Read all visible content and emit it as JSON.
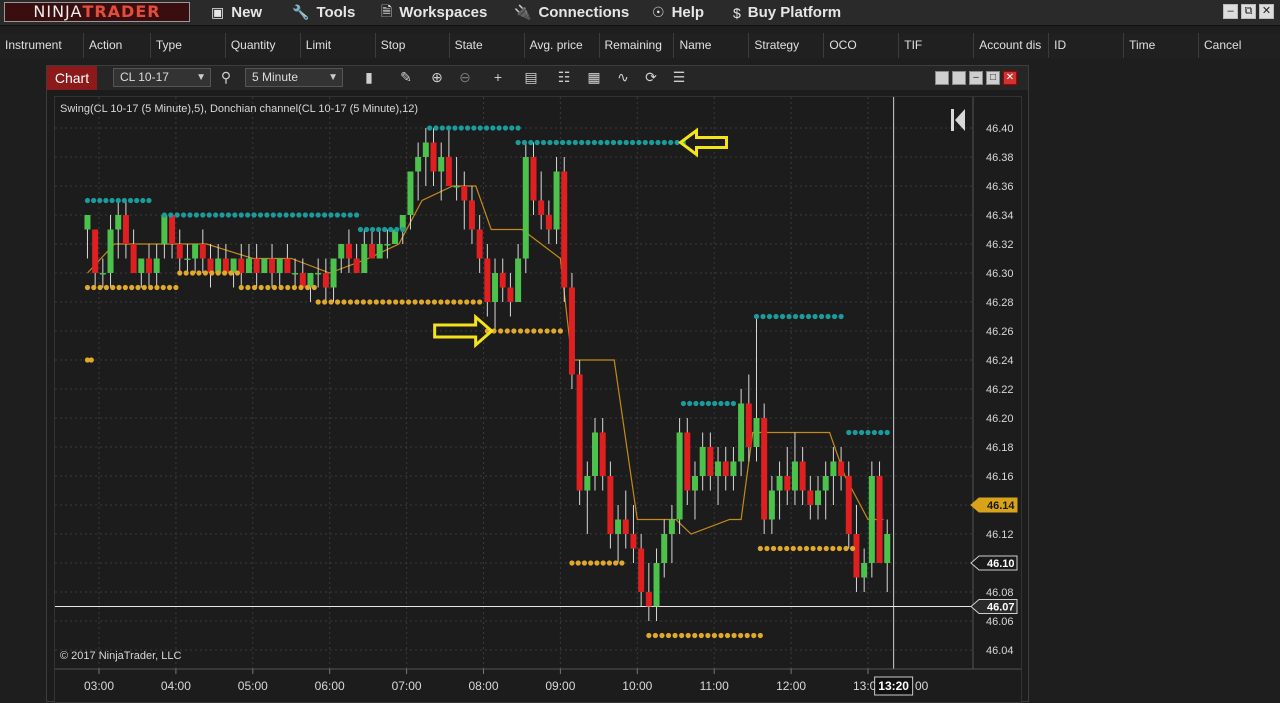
{
  "app": {
    "logo_left": "NINJA",
    "logo_right": "TRADER",
    "menu": [
      "New",
      "Tools",
      "Workspaces",
      "Connections",
      "Help",
      "Buy Platform"
    ]
  },
  "orders_columns": [
    "Instrument",
    "Action",
    "Type",
    "Quantity",
    "Limit",
    "Stop",
    "State",
    "Avg. price",
    "Remaining",
    "Name",
    "Strategy",
    "OCO",
    "TIF",
    "Account dis",
    "ID",
    "Time",
    "Cancel"
  ],
  "chart_window": {
    "tab": "Chart",
    "instrument": "CL 10-17",
    "interval": "5 Minute",
    "indicator_label": "Swing(CL 10-17 (5 Minute),5), Donchian channel(CL 10-17 (5 Minute),12)",
    "copyright": "© 2017 NinjaTrader, LLC",
    "crosshair_time": "13:20",
    "crosshair_trailing": "00"
  },
  "chart_data": {
    "type": "candlestick",
    "y_ticks": [
      "46.40",
      "46.38",
      "46.36",
      "46.34",
      "46.32",
      "46.30",
      "46.28",
      "46.26",
      "46.24",
      "46.22",
      "46.20",
      "46.18",
      "46.16",
      "46.14",
      "46.12",
      "46.10",
      "46.08",
      "46.06",
      "46.04"
    ],
    "x_ticks": [
      "03:00",
      "04:00",
      "05:00",
      "06:00",
      "07:00",
      "08:00",
      "09:00",
      "10:00",
      "11:00",
      "12:00",
      "13:00"
    ],
    "ylim": [
      46.03,
      46.42
    ],
    "price_markers": [
      {
        "label": "46.14",
        "value": 46.14,
        "color": "#d9a21b"
      },
      {
        "label": "46.10",
        "value": 46.1,
        "color": "#1a1a1a"
      },
      {
        "label": "46.07",
        "value": 46.07,
        "color": "#2a2a2a"
      }
    ],
    "horizontal_line": 46.07,
    "colors": {
      "up": "#4cc24c",
      "down": "#e02020",
      "swing_high": "#1a9c9c",
      "swing_low": "#e0a92a",
      "donchian": "#c48a1a",
      "arrow": "#f4e21a"
    },
    "swing_highs": [
      {
        "t0": 2.85,
        "t1": 3.65,
        "v": 46.35
      },
      {
        "t0": 3.85,
        "t1": 6.35,
        "v": 46.34
      },
      {
        "t0": 6.4,
        "t1": 6.95,
        "v": 46.33
      },
      {
        "t0": 7.3,
        "t1": 8.45,
        "v": 46.4
      },
      {
        "t0": 8.45,
        "t1": 10.6,
        "v": 46.39
      },
      {
        "t0": 11.55,
        "t1": 12.65,
        "v": 46.27
      },
      {
        "t0": 10.6,
        "t1": 11.25,
        "v": 46.21
      },
      {
        "t0": 12.75,
        "t1": 13.25,
        "v": 46.19
      }
    ],
    "swing_lows": [
      {
        "t0": 2.85,
        "t1": 4.0,
        "v": 46.29
      },
      {
        "t0": 4.05,
        "t1": 4.8,
        "v": 46.3
      },
      {
        "t0": 4.85,
        "t1": 5.8,
        "v": 46.29
      },
      {
        "t0": 5.85,
        "t1": 7.95,
        "v": 46.28
      },
      {
        "t0": 8.05,
        "t1": 9.0,
        "v": 46.26
      },
      {
        "t0": 9.15,
        "t1": 9.8,
        "v": 46.1
      },
      {
        "t0": 10.15,
        "t1": 11.6,
        "v": 46.05
      },
      {
        "t0": 11.6,
        "t1": 12.8,
        "v": 46.11
      },
      {
        "t0": 2.85,
        "t1": 2.9,
        "v": 46.24
      }
    ],
    "donchian_mid": [
      [
        2.85,
        46.3
      ],
      [
        3.2,
        46.32
      ],
      [
        3.8,
        46.32
      ],
      [
        4.4,
        46.32
      ],
      [
        5.0,
        46.31
      ],
      [
        5.5,
        46.31
      ],
      [
        6.0,
        46.3
      ],
      [
        6.5,
        46.31
      ],
      [
        6.9,
        46.32
      ],
      [
        7.2,
        46.35
      ],
      [
        7.6,
        46.36
      ],
      [
        7.9,
        46.36
      ],
      [
        8.1,
        46.33
      ],
      [
        8.5,
        46.33
      ],
      [
        9.0,
        46.31
      ],
      [
        9.15,
        46.24
      ],
      [
        9.7,
        46.24
      ],
      [
        10.0,
        46.13
      ],
      [
        10.5,
        46.13
      ],
      [
        10.7,
        46.12
      ],
      [
        11.2,
        46.13
      ],
      [
        11.35,
        46.13
      ],
      [
        11.5,
        46.19
      ],
      [
        12.5,
        46.19
      ],
      [
        12.7,
        46.16
      ],
      [
        13.0,
        46.13
      ],
      [
        13.2,
        46.13
      ]
    ],
    "candles": [
      {
        "t": 2.85,
        "o": 46.33,
        "h": 46.34,
        "l": 46.31,
        "c": 46.34
      },
      {
        "t": 2.95,
        "o": 46.33,
        "h": 46.33,
        "l": 46.29,
        "c": 46.3
      },
      {
        "t": 3.05,
        "o": 46.3,
        "h": 46.31,
        "l": 46.29,
        "c": 46.3
      },
      {
        "t": 3.15,
        "o": 46.3,
        "h": 46.34,
        "l": 46.29,
        "c": 46.33
      },
      {
        "t": 3.25,
        "o": 46.33,
        "h": 46.35,
        "l": 46.31,
        "c": 46.34
      },
      {
        "t": 3.35,
        "o": 46.34,
        "h": 46.35,
        "l": 46.31,
        "c": 46.32
      },
      {
        "t": 3.45,
        "o": 46.32,
        "h": 46.33,
        "l": 46.3,
        "c": 46.3
      },
      {
        "t": 3.55,
        "o": 46.3,
        "h": 46.31,
        "l": 46.29,
        "c": 46.31
      },
      {
        "t": 3.65,
        "o": 46.31,
        "h": 46.32,
        "l": 46.29,
        "c": 46.3
      },
      {
        "t": 3.75,
        "o": 46.3,
        "h": 46.32,
        "l": 46.29,
        "c": 46.31
      },
      {
        "t": 3.85,
        "o": 46.32,
        "h": 46.34,
        "l": 46.31,
        "c": 46.34
      },
      {
        "t": 3.95,
        "o": 46.34,
        "h": 46.34,
        "l": 46.31,
        "c": 46.32
      },
      {
        "t": 4.05,
        "o": 46.32,
        "h": 46.33,
        "l": 46.3,
        "c": 46.31
      },
      {
        "t": 4.15,
        "o": 46.31,
        "h": 46.32,
        "l": 46.3,
        "c": 46.31
      },
      {
        "t": 4.25,
        "o": 46.31,
        "h": 46.32,
        "l": 46.3,
        "c": 46.32
      },
      {
        "t": 4.35,
        "o": 46.32,
        "h": 46.33,
        "l": 46.3,
        "c": 46.31
      },
      {
        "t": 4.45,
        "o": 46.31,
        "h": 46.32,
        "l": 46.29,
        "c": 46.3
      },
      {
        "t": 4.55,
        "o": 46.3,
        "h": 46.32,
        "l": 46.3,
        "c": 46.31
      },
      {
        "t": 4.65,
        "o": 46.31,
        "h": 46.32,
        "l": 46.3,
        "c": 46.3
      },
      {
        "t": 4.75,
        "o": 46.3,
        "h": 46.31,
        "l": 46.29,
        "c": 46.31
      },
      {
        "t": 4.85,
        "o": 46.31,
        "h": 46.32,
        "l": 46.29,
        "c": 46.3
      },
      {
        "t": 4.95,
        "o": 46.3,
        "h": 46.32,
        "l": 46.3,
        "c": 46.31
      },
      {
        "t": 5.05,
        "o": 46.31,
        "h": 46.32,
        "l": 46.29,
        "c": 46.3
      },
      {
        "t": 5.15,
        "o": 46.3,
        "h": 46.31,
        "l": 46.3,
        "c": 46.31
      },
      {
        "t": 5.25,
        "o": 46.31,
        "h": 46.32,
        "l": 46.29,
        "c": 46.3
      },
      {
        "t": 5.35,
        "o": 46.3,
        "h": 46.31,
        "l": 46.29,
        "c": 46.31
      },
      {
        "t": 5.45,
        "o": 46.31,
        "h": 46.32,
        "l": 46.3,
        "c": 46.3
      },
      {
        "t": 5.55,
        "o": 46.3,
        "h": 46.31,
        "l": 46.29,
        "c": 46.3
      },
      {
        "t": 5.65,
        "o": 46.3,
        "h": 46.31,
        "l": 46.29,
        "c": 46.29
      },
      {
        "t": 5.75,
        "o": 46.29,
        "h": 46.3,
        "l": 46.28,
        "c": 46.3
      },
      {
        "t": 5.85,
        "o": 46.3,
        "h": 46.31,
        "l": 46.29,
        "c": 46.3
      },
      {
        "t": 5.95,
        "o": 46.3,
        "h": 46.31,
        "l": 46.28,
        "c": 46.29
      },
      {
        "t": 6.05,
        "o": 46.29,
        "h": 46.31,
        "l": 46.28,
        "c": 46.31
      },
      {
        "t": 6.15,
        "o": 46.31,
        "h": 46.32,
        "l": 46.3,
        "c": 46.32
      },
      {
        "t": 6.25,
        "o": 46.32,
        "h": 46.33,
        "l": 46.3,
        "c": 46.31
      },
      {
        "t": 6.35,
        "o": 46.31,
        "h": 46.32,
        "l": 46.3,
        "c": 46.3
      },
      {
        "t": 6.45,
        "o": 46.3,
        "h": 46.33,
        "l": 46.3,
        "c": 46.32
      },
      {
        "t": 6.55,
        "o": 46.32,
        "h": 46.33,
        "l": 46.31,
        "c": 46.31
      },
      {
        "t": 6.65,
        "o": 46.31,
        "h": 46.33,
        "l": 46.31,
        "c": 46.32
      },
      {
        "t": 6.75,
        "o": 46.32,
        "h": 46.33,
        "l": 46.31,
        "c": 46.32
      },
      {
        "t": 6.85,
        "o": 46.32,
        "h": 46.33,
        "l": 46.32,
        "c": 46.33
      },
      {
        "t": 6.95,
        "o": 46.33,
        "h": 46.34,
        "l": 46.32,
        "c": 46.34
      },
      {
        "t": 7.05,
        "o": 46.34,
        "h": 46.37,
        "l": 46.33,
        "c": 46.37
      },
      {
        "t": 7.15,
        "o": 46.37,
        "h": 46.39,
        "l": 46.35,
        "c": 46.38
      },
      {
        "t": 7.25,
        "o": 46.38,
        "h": 46.4,
        "l": 46.36,
        "c": 46.39
      },
      {
        "t": 7.35,
        "o": 46.39,
        "h": 46.4,
        "l": 46.36,
        "c": 46.37
      },
      {
        "t": 7.45,
        "o": 46.37,
        "h": 46.39,
        "l": 46.35,
        "c": 46.38
      },
      {
        "t": 7.55,
        "o": 46.38,
        "h": 46.4,
        "l": 46.36,
        "c": 46.36
      },
      {
        "t": 7.65,
        "o": 46.36,
        "h": 46.38,
        "l": 46.35,
        "c": 46.36
      },
      {
        "t": 7.75,
        "o": 46.36,
        "h": 46.37,
        "l": 46.33,
        "c": 46.35
      },
      {
        "t": 7.85,
        "o": 46.35,
        "h": 46.36,
        "l": 46.32,
        "c": 46.33
      },
      {
        "t": 7.95,
        "o": 46.33,
        "h": 46.34,
        "l": 46.3,
        "c": 46.31
      },
      {
        "t": 8.05,
        "o": 46.31,
        "h": 46.32,
        "l": 46.27,
        "c": 46.28
      },
      {
        "t": 8.15,
        "o": 46.28,
        "h": 46.31,
        "l": 46.26,
        "c": 46.3
      },
      {
        "t": 8.25,
        "o": 46.3,
        "h": 46.31,
        "l": 46.28,
        "c": 46.29
      },
      {
        "t": 8.35,
        "o": 46.29,
        "h": 46.3,
        "l": 46.27,
        "c": 46.28
      },
      {
        "t": 8.45,
        "o": 46.28,
        "h": 46.32,
        "l": 46.28,
        "c": 46.31
      },
      {
        "t": 8.55,
        "o": 46.31,
        "h": 46.39,
        "l": 46.3,
        "c": 46.38
      },
      {
        "t": 8.65,
        "o": 46.38,
        "h": 46.39,
        "l": 46.34,
        "c": 46.35
      },
      {
        "t": 8.75,
        "o": 46.35,
        "h": 46.37,
        "l": 46.33,
        "c": 46.34
      },
      {
        "t": 8.85,
        "o": 46.34,
        "h": 46.35,
        "l": 46.32,
        "c": 46.33
      },
      {
        "t": 8.95,
        "o": 46.33,
        "h": 46.38,
        "l": 46.32,
        "c": 46.37
      },
      {
        "t": 9.05,
        "o": 46.37,
        "h": 46.38,
        "l": 46.28,
        "c": 46.29
      },
      {
        "t": 9.15,
        "o": 46.29,
        "h": 46.3,
        "l": 46.22,
        "c": 46.23
      },
      {
        "t": 9.25,
        "o": 46.23,
        "h": 46.24,
        "l": 46.14,
        "c": 46.15
      },
      {
        "t": 9.35,
        "o": 46.15,
        "h": 46.17,
        "l": 46.12,
        "c": 46.16
      },
      {
        "t": 9.45,
        "o": 46.16,
        "h": 46.2,
        "l": 46.15,
        "c": 46.19
      },
      {
        "t": 9.55,
        "o": 46.19,
        "h": 46.2,
        "l": 46.15,
        "c": 46.16
      },
      {
        "t": 9.65,
        "o": 46.16,
        "h": 46.17,
        "l": 46.11,
        "c": 46.12
      },
      {
        "t": 9.75,
        "o": 46.12,
        "h": 46.14,
        "l": 46.1,
        "c": 46.13
      },
      {
        "t": 9.85,
        "o": 46.13,
        "h": 46.15,
        "l": 46.11,
        "c": 46.12
      },
      {
        "t": 9.95,
        "o": 46.12,
        "h": 46.14,
        "l": 46.1,
        "c": 46.11
      },
      {
        "t": 10.05,
        "o": 46.11,
        "h": 46.12,
        "l": 46.07,
        "c": 46.08
      },
      {
        "t": 10.15,
        "o": 46.08,
        "h": 46.1,
        "l": 46.06,
        "c": 46.07
      },
      {
        "t": 10.25,
        "o": 46.07,
        "h": 46.11,
        "l": 46.06,
        "c": 46.1
      },
      {
        "t": 10.35,
        "o": 46.1,
        "h": 46.13,
        "l": 46.09,
        "c": 46.12
      },
      {
        "t": 10.45,
        "o": 46.12,
        "h": 46.14,
        "l": 46.1,
        "c": 46.13
      },
      {
        "t": 10.55,
        "o": 46.13,
        "h": 46.2,
        "l": 46.12,
        "c": 46.19
      },
      {
        "t": 10.65,
        "o": 46.19,
        "h": 46.2,
        "l": 46.14,
        "c": 46.15
      },
      {
        "t": 10.75,
        "o": 46.15,
        "h": 46.17,
        "l": 46.13,
        "c": 46.16
      },
      {
        "t": 10.85,
        "o": 46.16,
        "h": 46.19,
        "l": 46.15,
        "c": 46.18
      },
      {
        "t": 10.95,
        "o": 46.18,
        "h": 46.19,
        "l": 46.15,
        "c": 46.16
      },
      {
        "t": 11.05,
        "o": 46.16,
        "h": 46.18,
        "l": 46.14,
        "c": 46.17
      },
      {
        "t": 11.15,
        "o": 46.17,
        "h": 46.18,
        "l": 46.15,
        "c": 46.16
      },
      {
        "t": 11.25,
        "o": 46.16,
        "h": 46.18,
        "l": 46.15,
        "c": 46.17
      },
      {
        "t": 11.35,
        "o": 46.17,
        "h": 46.22,
        "l": 46.16,
        "c": 46.21
      },
      {
        "t": 11.45,
        "o": 46.21,
        "h": 46.23,
        "l": 46.17,
        "c": 46.18
      },
      {
        "t": 11.55,
        "o": 46.18,
        "h": 46.27,
        "l": 46.17,
        "c": 46.2
      },
      {
        "t": 11.65,
        "o": 46.2,
        "h": 46.21,
        "l": 46.12,
        "c": 46.13
      },
      {
        "t": 11.75,
        "o": 46.13,
        "h": 46.16,
        "l": 46.12,
        "c": 46.15
      },
      {
        "t": 11.85,
        "o": 46.15,
        "h": 46.17,
        "l": 46.13,
        "c": 46.16
      },
      {
        "t": 11.95,
        "o": 46.16,
        "h": 46.18,
        "l": 46.14,
        "c": 46.15
      },
      {
        "t": 12.05,
        "o": 46.15,
        "h": 46.19,
        "l": 46.14,
        "c": 46.17
      },
      {
        "t": 12.15,
        "o": 46.17,
        "h": 46.18,
        "l": 46.14,
        "c": 46.15
      },
      {
        "t": 12.25,
        "o": 46.15,
        "h": 46.16,
        "l": 46.13,
        "c": 46.14
      },
      {
        "t": 12.35,
        "o": 46.14,
        "h": 46.16,
        "l": 46.13,
        "c": 46.15
      },
      {
        "t": 12.45,
        "o": 46.15,
        "h": 46.17,
        "l": 46.13,
        "c": 46.16
      },
      {
        "t": 12.55,
        "o": 46.16,
        "h": 46.18,
        "l": 46.14,
        "c": 46.17
      },
      {
        "t": 12.65,
        "o": 46.17,
        "h": 46.18,
        "l": 46.15,
        "c": 46.16
      },
      {
        "t": 12.75,
        "o": 46.16,
        "h": 46.17,
        "l": 46.11,
        "c": 46.12
      },
      {
        "t": 12.85,
        "o": 46.12,
        "h": 46.14,
        "l": 46.08,
        "c": 46.09
      },
      {
        "t": 12.95,
        "o": 46.09,
        "h": 46.11,
        "l": 46.08,
        "c": 46.1
      },
      {
        "t": 13.05,
        "o": 46.1,
        "h": 46.17,
        "l": 46.09,
        "c": 46.16
      },
      {
        "t": 13.15,
        "o": 46.16,
        "h": 46.17,
        "l": 46.1,
        "c": 46.1
      },
      {
        "t": 13.25,
        "o": 46.1,
        "h": 46.13,
        "l": 46.08,
        "c": 46.12
      }
    ]
  }
}
